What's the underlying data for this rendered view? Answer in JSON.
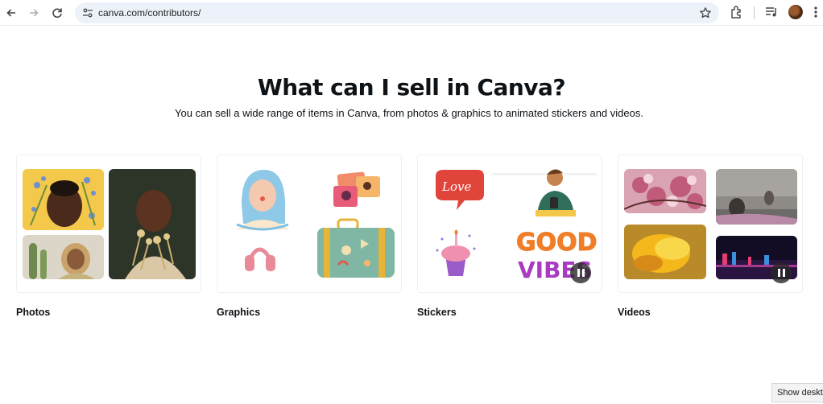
{
  "browser": {
    "url": "canva.com/contributors/",
    "icons": [
      "back-icon",
      "forward-icon",
      "reload-icon",
      "site-settings-icon",
      "bookmark-star-icon",
      "extensions-icon",
      "media-controls-icon",
      "profile-avatar",
      "menu-icon"
    ]
  },
  "section": {
    "title": "What can I sell in Canva?",
    "subtitle": "You can sell a wide range of items in Canva, from photos & graphics to animated stickers and videos."
  },
  "categories": [
    {
      "label": "Photos"
    },
    {
      "label": "Graphics"
    },
    {
      "label": "Stickers",
      "sticker_texts": [
        "Love",
        "GOOD",
        "VIBES"
      ]
    },
    {
      "label": "Videos"
    }
  ],
  "tooltip": "Show desktop",
  "colors": {
    "text": "#0e1318",
    "omnibox": "#edf2fa",
    "sticker_love": "#e0443a",
    "sticker_good": "#f07d27",
    "sticker_vibes": "#a83bbf"
  }
}
